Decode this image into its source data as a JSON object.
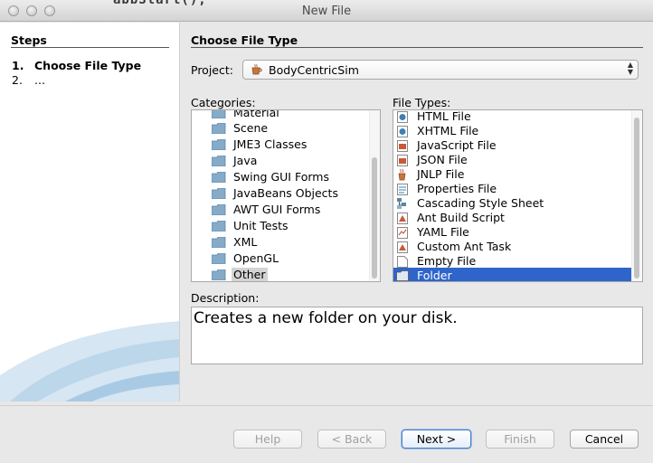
{
  "window": {
    "title": "New File",
    "background_text": "abbStart();"
  },
  "steps": {
    "title": "Steps",
    "items": [
      {
        "number": "1.",
        "label": "Choose File Type",
        "active": true
      },
      {
        "number": "2.",
        "label": "...",
        "active": false
      }
    ]
  },
  "main": {
    "heading": "Choose File Type",
    "project_label": "Project:",
    "project_value": "BodyCentricSim",
    "categories_label": "Categories:",
    "file_types_label": "File Types:",
    "description_label": "Description:",
    "description_text": "Creates a new folder on your disk."
  },
  "categories": {
    "items": [
      "Material",
      "Scene",
      "JME3 Classes",
      "Java",
      "Swing GUI Forms",
      "JavaBeans Objects",
      "AWT GUI Forms",
      "Unit Tests",
      "XML",
      "OpenGL",
      "Other"
    ],
    "selected": "Other"
  },
  "file_types": {
    "items": [
      {
        "label": "HTML File",
        "icon": "html-file-icon"
      },
      {
        "label": "XHTML File",
        "icon": "xhtml-file-icon"
      },
      {
        "label": "JavaScript File",
        "icon": "javascript-file-icon"
      },
      {
        "label": "JSON File",
        "icon": "json-file-icon"
      },
      {
        "label": "JNLP File",
        "icon": "jnlp-file-icon"
      },
      {
        "label": "Properties File",
        "icon": "properties-file-icon"
      },
      {
        "label": "Cascading Style Sheet",
        "icon": "css-file-icon"
      },
      {
        "label": "Ant Build Script",
        "icon": "ant-script-icon"
      },
      {
        "label": "YAML File",
        "icon": "yaml-file-icon"
      },
      {
        "label": "Custom Ant Task",
        "icon": "ant-task-icon"
      },
      {
        "label": "Empty File",
        "icon": "empty-file-icon"
      },
      {
        "label": "Folder",
        "icon": "folder-icon"
      }
    ],
    "selected": "Folder"
  },
  "buttons": {
    "help": "Help",
    "back": "< Back",
    "next": "Next >",
    "finish": "Finish",
    "cancel": "Cancel"
  },
  "colors": {
    "selection": "#2f65ca",
    "folder": "#7ea8c8",
    "accent": "#4a7ec8"
  }
}
